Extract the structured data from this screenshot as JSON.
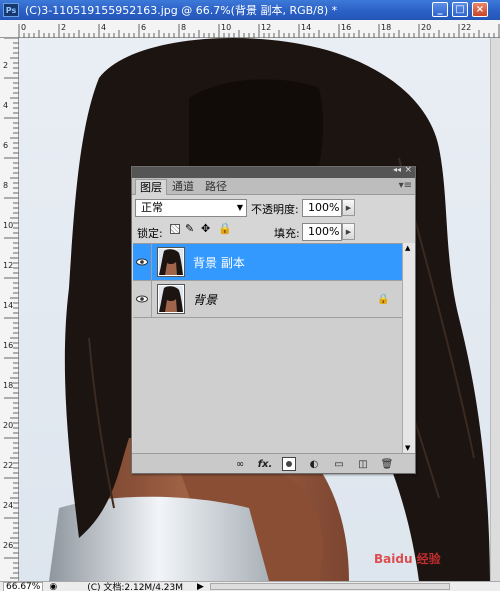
{
  "window": {
    "app_icon": "Ps",
    "title": "(C)3-110519155952163.jpg @ 66.7%(背景 副本, RGB/8) *",
    "minimize": "_",
    "maximize": "□",
    "close": "×"
  },
  "rulers": {
    "top_ticks": [
      "0",
      "2",
      "4",
      "6",
      "8",
      "10",
      "12",
      "14",
      "16",
      "18",
      "20",
      "22"
    ],
    "left_ticks": [
      "2",
      "4",
      "6",
      "8",
      "10",
      "12",
      "14",
      "16",
      "18",
      "20",
      "22",
      "24",
      "26"
    ]
  },
  "layers_panel": {
    "collapse_glyph": "◂◂",
    "close_glyph": "×",
    "tabs": [
      "图层",
      "通道",
      "路径"
    ],
    "menu_icon": "panel-menu-icon",
    "blend_mode": "正常",
    "opacity_label": "不透明度:",
    "opacity_value": "100%",
    "lock_label": "锁定:",
    "fill_label": "填充:",
    "fill_value": "100%",
    "layers": [
      {
        "name": "背景 副本",
        "selected": true,
        "locked": false
      },
      {
        "name": "背景",
        "selected": false,
        "locked": true
      }
    ],
    "bottom_icons": [
      "link-icon",
      "fx-icon",
      "mask-icon",
      "adjustment-icon",
      "folder-icon",
      "new-layer-icon",
      "trash-icon"
    ],
    "fx_label": "fx."
  },
  "statusbar": {
    "zoom": "66.67%",
    "doc_info": "(C) 文档:2.12M/4.23M"
  },
  "watermark": "Baidu 经验",
  "colors": {
    "selected_layer": "#3399ff",
    "title_bar": "#2a5fc4",
    "panel_bg": "#d6d6d6"
  }
}
